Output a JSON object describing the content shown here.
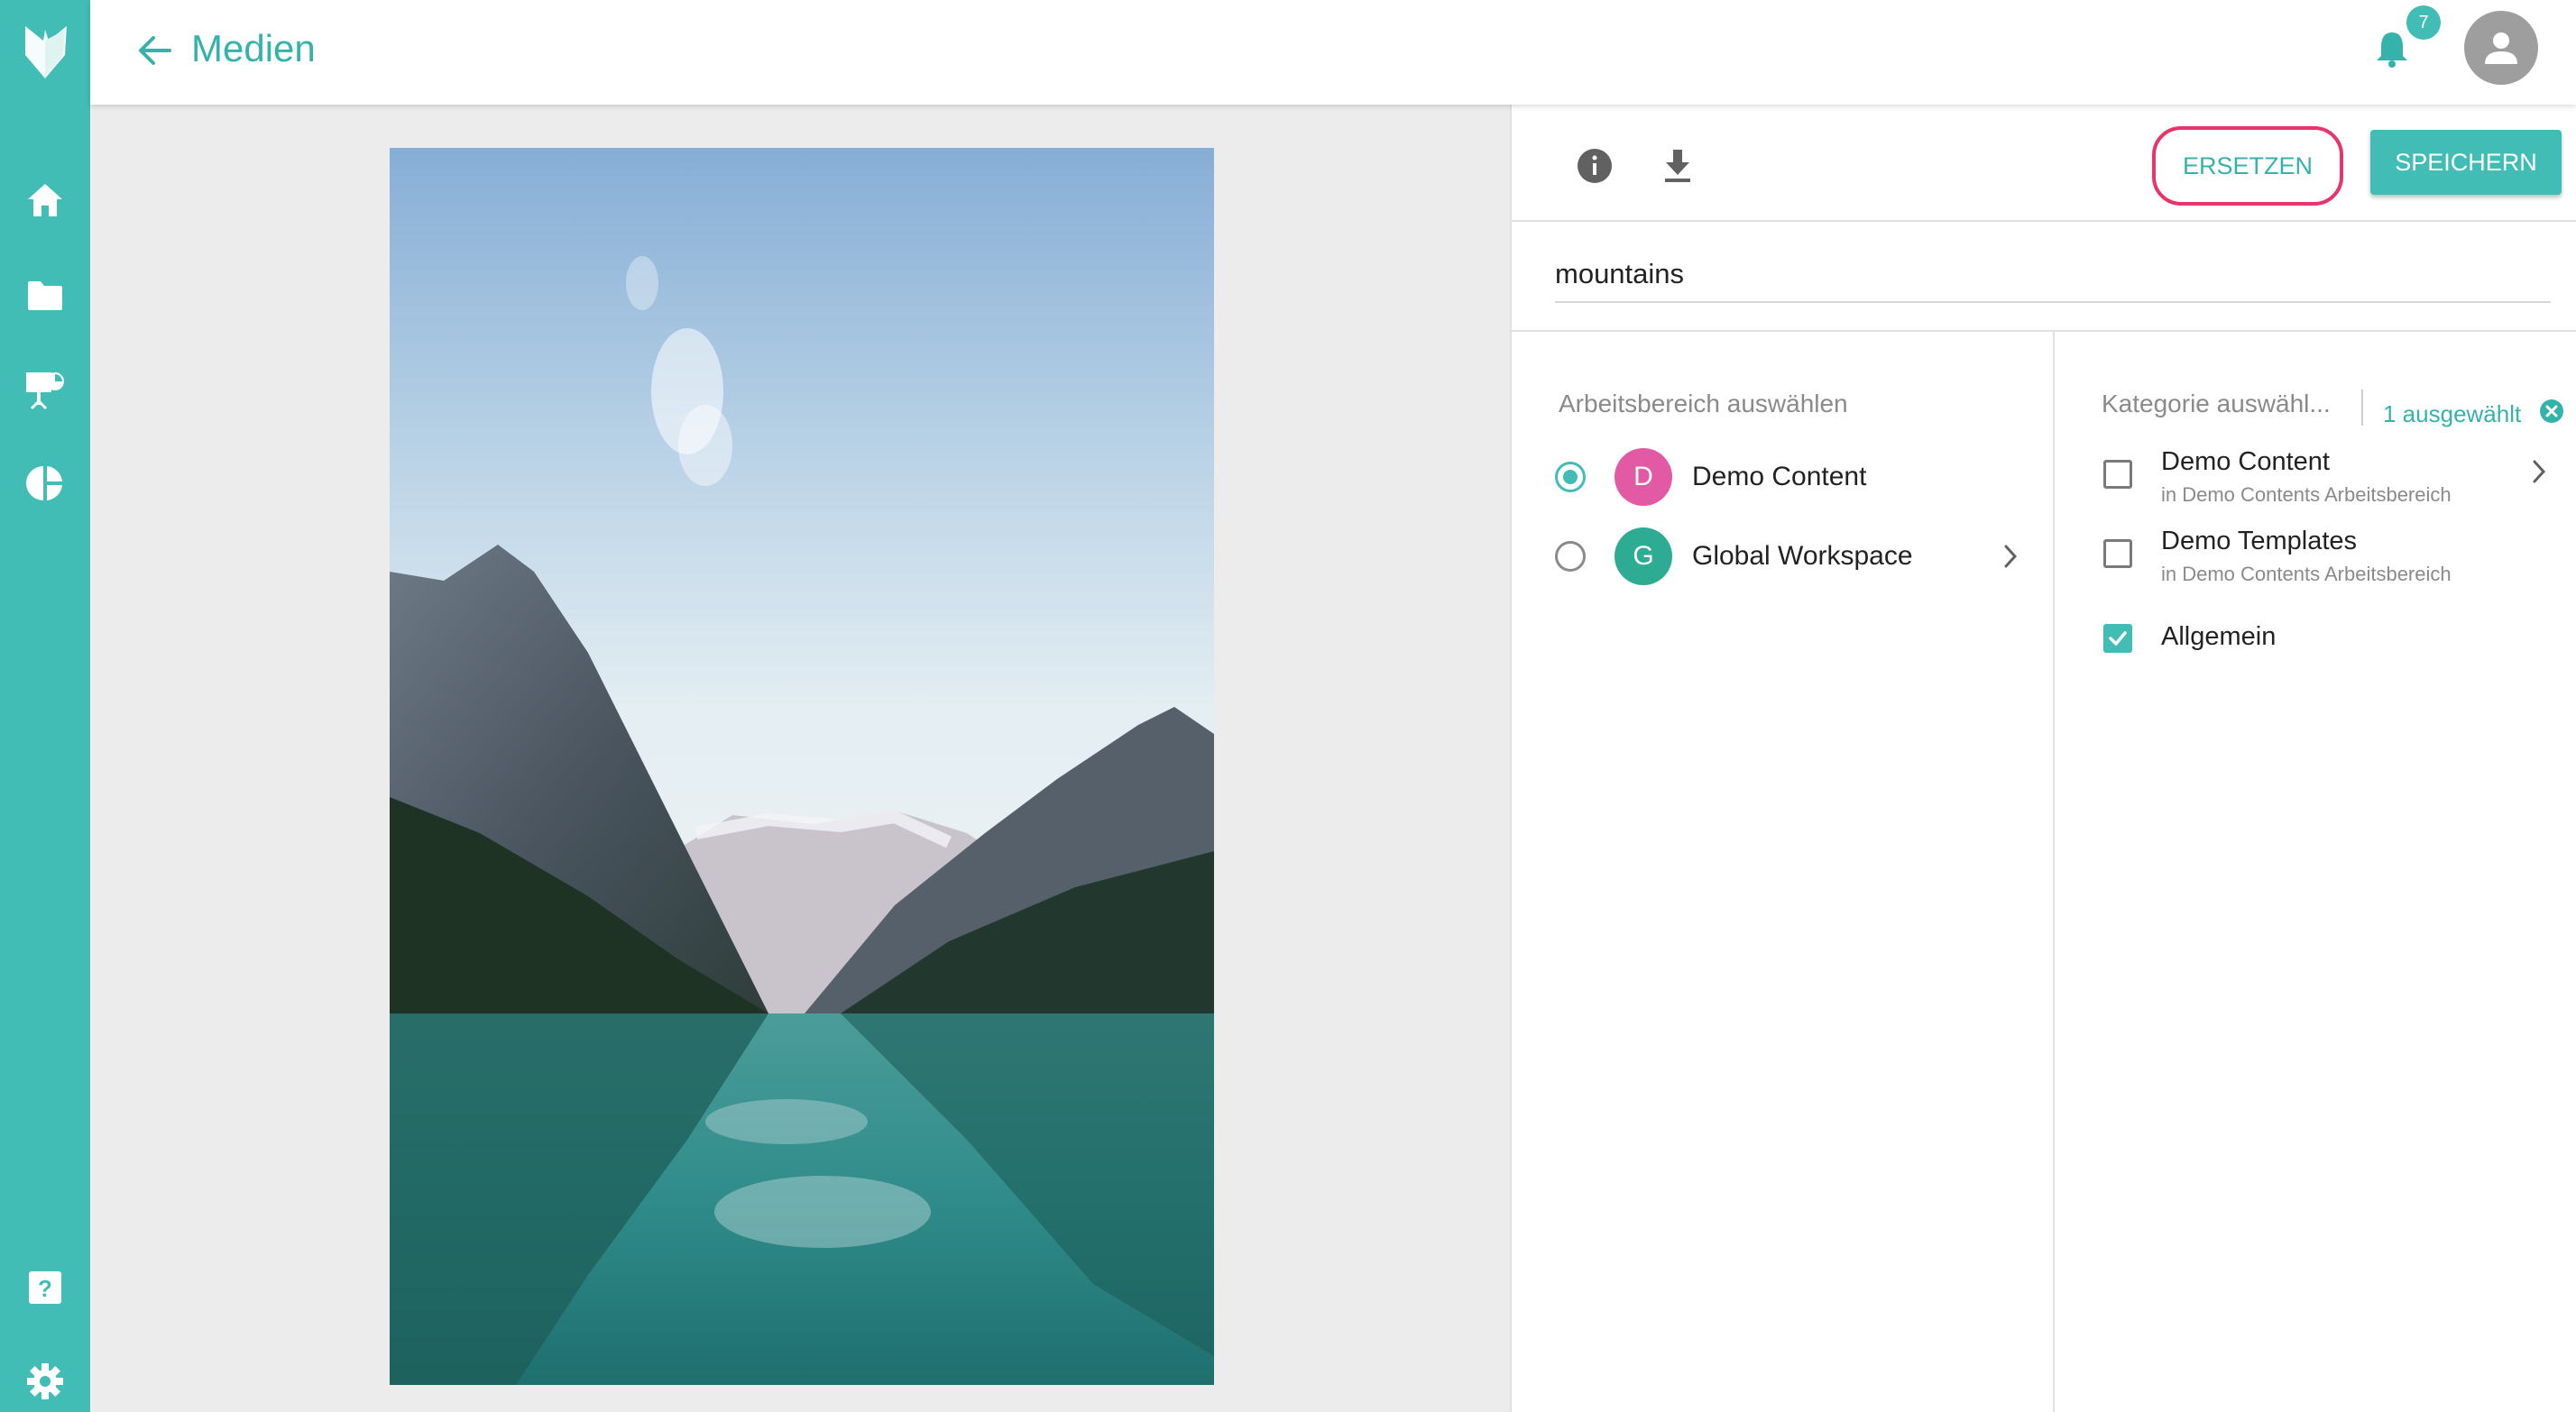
{
  "header": {
    "title": "Medien",
    "notification_count": "7"
  },
  "sidebar": {
    "top_items": [
      "home-icon",
      "folder-icon",
      "presentation-icon",
      "pie-chart-icon"
    ],
    "bottom_items": [
      "help-icon",
      "gear-icon"
    ]
  },
  "toolbar": {
    "replace_label": "ERSETZEN",
    "save_label": "SPEICHERN"
  },
  "media": {
    "name_value": "mountains"
  },
  "workspace": {
    "label": "Arbeitsbereich auswählen",
    "items": [
      {
        "initial": "D",
        "name": "Demo Content",
        "selected": true,
        "color": "#e35aa4"
      },
      {
        "initial": "G",
        "name": "Global Workspace",
        "selected": false,
        "color": "#2eac93"
      }
    ]
  },
  "category": {
    "label": "Kategorie auswähl...",
    "selected_count": "1 ausgewählt",
    "items": [
      {
        "name": "Demo Content",
        "sub": "in Demo Contents Arbeitsbereich",
        "checked": false
      },
      {
        "name": "Demo Templates",
        "sub": "in Demo Contents Arbeitsbereich",
        "checked": false
      },
      {
        "name": "Allgemein",
        "sub": "",
        "checked": true
      }
    ]
  },
  "colors": {
    "accent": "#41bdb5",
    "highlight_ring": "#e8336b"
  }
}
